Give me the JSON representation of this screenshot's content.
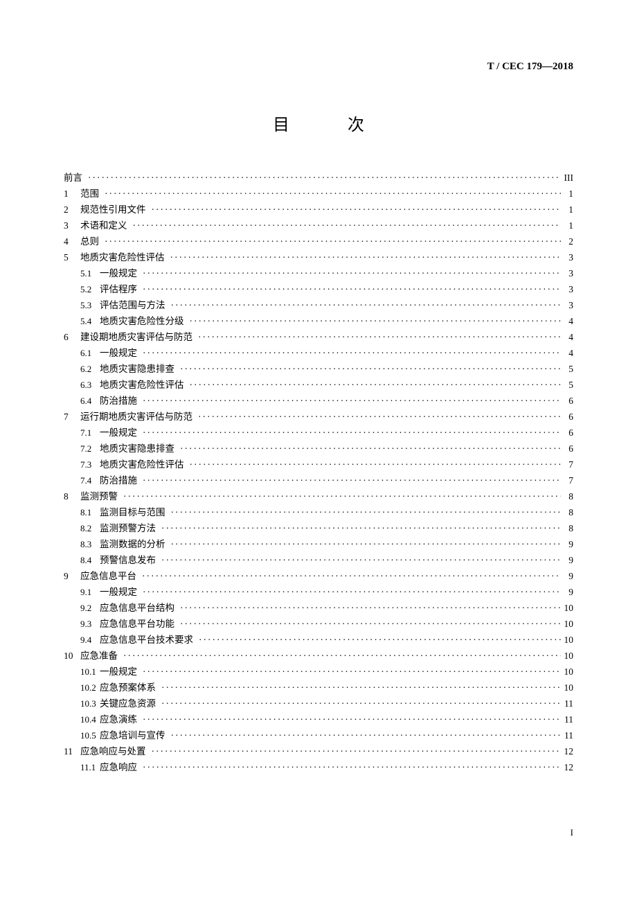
{
  "header": {
    "code": "T / CEC 179—2018"
  },
  "title": "目　次",
  "footer": {
    "page": "I"
  },
  "toc": [
    {
      "level": 1,
      "num": "",
      "title": "前言",
      "page": "III"
    },
    {
      "level": 1,
      "num": "1",
      "title": "范围",
      "page": "1"
    },
    {
      "level": 1,
      "num": "2",
      "title": "规范性引用文件",
      "page": "1"
    },
    {
      "level": 1,
      "num": "3",
      "title": "术语和定义",
      "page": "1"
    },
    {
      "level": 1,
      "num": "4",
      "title": "总则",
      "page": "2"
    },
    {
      "level": 1,
      "num": "5",
      "title": "地质灾害危险性评估",
      "page": "3"
    },
    {
      "level": 2,
      "num": "5.1",
      "title": "一般规定",
      "page": "3"
    },
    {
      "level": 2,
      "num": "5.2",
      "title": "评估程序",
      "page": "3"
    },
    {
      "level": 2,
      "num": "5.3",
      "title": "评估范围与方法",
      "page": "3"
    },
    {
      "level": 2,
      "num": "5.4",
      "title": "地质灾害危险性分级",
      "page": "4"
    },
    {
      "level": 1,
      "num": "6",
      "title": "建设期地质灾害评估与防范",
      "page": "4"
    },
    {
      "level": 2,
      "num": "6.1",
      "title": "一般规定",
      "page": "4"
    },
    {
      "level": 2,
      "num": "6.2",
      "title": "地质灾害隐患排查",
      "page": "5"
    },
    {
      "level": 2,
      "num": "6.3",
      "title": "地质灾害危险性评估",
      "page": "5"
    },
    {
      "level": 2,
      "num": "6.4",
      "title": "防治措施",
      "page": "6"
    },
    {
      "level": 1,
      "num": "7",
      "title": "运行期地质灾害评估与防范",
      "page": "6"
    },
    {
      "level": 2,
      "num": "7.1",
      "title": "一般规定",
      "page": "6"
    },
    {
      "level": 2,
      "num": "7.2",
      "title": "地质灾害隐患排查",
      "page": "6"
    },
    {
      "level": 2,
      "num": "7.3",
      "title": "地质灾害危险性评估",
      "page": "7"
    },
    {
      "level": 2,
      "num": "7.4",
      "title": "防治措施",
      "page": "7"
    },
    {
      "level": 1,
      "num": "8",
      "title": "监测预警",
      "page": "8"
    },
    {
      "level": 2,
      "num": "8.1",
      "title": "监测目标与范围",
      "page": "8"
    },
    {
      "level": 2,
      "num": "8.2",
      "title": "监测预警方法",
      "page": "8"
    },
    {
      "level": 2,
      "num": "8.3",
      "title": "监测数据的分析",
      "page": "9"
    },
    {
      "level": 2,
      "num": "8.4",
      "title": "预警信息发布",
      "page": "9"
    },
    {
      "level": 1,
      "num": "9",
      "title": "应急信息平台",
      "page": "9"
    },
    {
      "level": 2,
      "num": "9.1",
      "title": "一般规定",
      "page": "9"
    },
    {
      "level": 2,
      "num": "9.2",
      "title": "应急信息平台结构",
      "page": "10"
    },
    {
      "level": 2,
      "num": "9.3",
      "title": "应急信息平台功能",
      "page": "10"
    },
    {
      "level": 2,
      "num": "9.4",
      "title": "应急信息平台技术要求",
      "page": "10"
    },
    {
      "level": 1,
      "num": "10",
      "title": "应急准备",
      "page": "10"
    },
    {
      "level": 2,
      "num": "10.1",
      "title": "一般规定",
      "page": "10"
    },
    {
      "level": 2,
      "num": "10.2",
      "title": "应急预案体系",
      "page": "10"
    },
    {
      "level": 2,
      "num": "10.3",
      "title": "关键应急资源",
      "page": "11"
    },
    {
      "level": 2,
      "num": "10.4",
      "title": "应急演练",
      "page": "11"
    },
    {
      "level": 2,
      "num": "10.5",
      "title": "应急培训与宣传",
      "page": "11"
    },
    {
      "level": 1,
      "num": "11",
      "title": "应急响应与处置",
      "page": "12"
    },
    {
      "level": 2,
      "num": "11.1",
      "title": "应急响应",
      "page": "12"
    }
  ]
}
